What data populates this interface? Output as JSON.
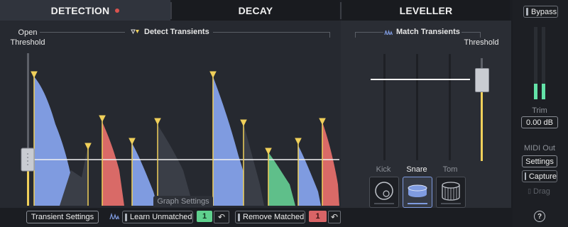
{
  "tabs": [
    {
      "label": "DETECTION",
      "active": true
    },
    {
      "label": "DECAY",
      "active": false
    },
    {
      "label": "LEVELLER",
      "active": false
    }
  ],
  "detection": {
    "open_threshold_label_line1": "Open",
    "open_threshold_label_line2": "Threshold",
    "detect_transients_label": "Detect Transients",
    "graph_settings_label": "Graph Settings"
  },
  "match": {
    "title": "Match Transients",
    "threshold_label": "Threshold",
    "instruments": [
      {
        "label": "Kick",
        "selected": false
      },
      {
        "label": "Snare",
        "selected": true
      },
      {
        "label": "Tom",
        "selected": false
      }
    ]
  },
  "bottom": {
    "transient_settings_label": "Transient Settings",
    "learn_unmatched_label": "Learn Unmatched",
    "learn_count": "1",
    "remove_matched_label": "Remove Matched",
    "remove_count": "1",
    "undo_glyph": "↶"
  },
  "right": {
    "bypass_label": "Bypass",
    "trim_label": "Trim",
    "trim_value": "0.00 dB",
    "midi_out_label": "MIDI Out",
    "settings_label": "Settings",
    "capture_label": "Capture",
    "drag_label": "Drag",
    "help_label": "?"
  },
  "colors": {
    "blue": "#7f9be0",
    "red": "#d96a67",
    "green": "#5fbf8a",
    "marker": "#f0d05a",
    "accent_green": "#63e3a8",
    "count_green": "#5fd18e",
    "count_red": "#d96466"
  }
}
